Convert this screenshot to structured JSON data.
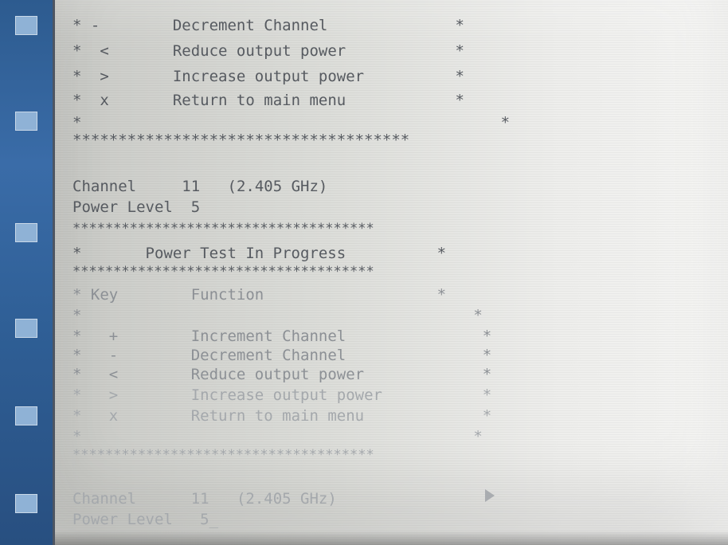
{
  "desktop": {
    "icons": [
      {
        "label": "",
        "name": "desk-icon-1"
      },
      {
        "label": "",
        "name": "desk-icon-2"
      },
      {
        "label": "",
        "name": "desk-icon-3"
      },
      {
        "label": "",
        "name": "desk-icon-4"
      }
    ]
  },
  "terminal": {
    "top_menu": [
      {
        "key": "-",
        "text": "Decrement Channel"
      },
      {
        "key": "<",
        "text": "Reduce output power"
      },
      {
        "key": ">",
        "text": "Increase output power"
      },
      {
        "key": "x",
        "text": "Return to main menu"
      }
    ],
    "star_border": "*************************************",
    "status1": {
      "channel_label": "Channel",
      "channel_value": "11",
      "frequency": "(2.405 GHz)",
      "power_label": "Power Level",
      "power_value": "5"
    },
    "test_banner": "Power Test In Progress",
    "header": {
      "key": "Key",
      "function": "Function"
    },
    "menu": [
      {
        "key": "+",
        "text": "Increment Channel"
      },
      {
        "key": "-",
        "text": "Decrement Channel"
      },
      {
        "key": "<",
        "text": "Reduce output power"
      },
      {
        "key": ">",
        "text": "Increase output power"
      },
      {
        "key": "x",
        "text": "Return to main menu"
      }
    ],
    "status2": {
      "channel_label": "Channel",
      "channel_value": "11",
      "frequency": "(2.405 GHz)",
      "power_label": "Power Level",
      "power_value": "5_"
    },
    "star": "*"
  }
}
